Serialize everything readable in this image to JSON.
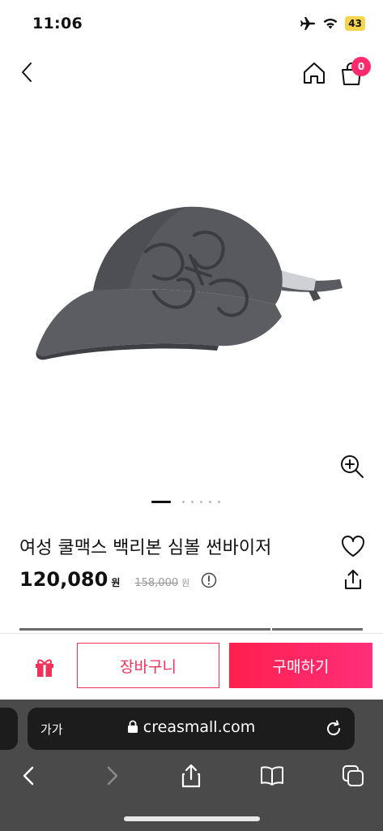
{
  "status_bar": {
    "time": "11:06",
    "battery": "43"
  },
  "header": {
    "cart_count": "0"
  },
  "gallery": {
    "total_dots": 6,
    "active_index": 0
  },
  "product": {
    "title": "여성 쿨맥스 백리본 심볼 썬바이저",
    "price": "120,080",
    "price_unit": "원",
    "original_price": "158,000",
    "original_price_unit": "원"
  },
  "actions": {
    "cart_label": "장바구니",
    "buy_label": "구매하기"
  },
  "browser": {
    "aa_label": "가가",
    "url": "creasmall.com"
  },
  "colors": {
    "accent": "#ff2a6d",
    "accent_border": "#f0325a"
  }
}
